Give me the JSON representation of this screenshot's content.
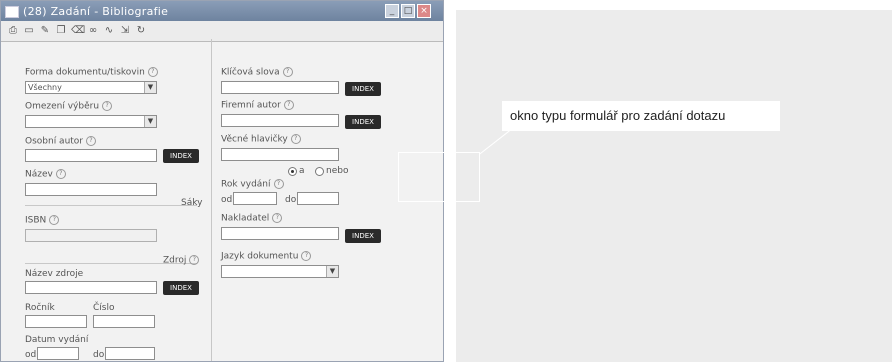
{
  "window": {
    "title": "(28) Zadání - Bibliografie",
    "minimize": "_",
    "maximize": "□",
    "close": "×"
  },
  "toolbar_icons": [
    "print-icon",
    "new-icon",
    "edit-icon",
    "copy-icon",
    "delete-icon",
    "binoculars-icon",
    "attach-icon",
    "export-icon",
    "refresh-icon"
  ],
  "left": {
    "doc_type": {
      "label": "Forma dokumentu/tiskovin",
      "value": "Všechny"
    },
    "collection": {
      "label": "Omezení výběru",
      "value": ""
    },
    "personal_author": {
      "label": "Osobní autor",
      "value": ""
    },
    "title": {
      "label": "Název",
      "value": ""
    },
    "uniform_title_label": "Sáky",
    "isbn": {
      "label": "ISBN",
      "value": ""
    },
    "source_label": "Zdroj",
    "source_title": {
      "label": "Název zdroje",
      "value": ""
    },
    "volume": {
      "label": "Ročník",
      "value": ""
    },
    "number": {
      "label": "Číslo",
      "value": ""
    },
    "year_issue": {
      "label": "Datum vydání"
    },
    "from_label": "od",
    "to_label": "do"
  },
  "right": {
    "keywords": {
      "label": "Klíčová slova",
      "value": ""
    },
    "corporate_author": {
      "label": "Firemní autor",
      "value": ""
    },
    "subject_author": {
      "label": "Věcné hlavičky",
      "value": ""
    },
    "radio_a": "a",
    "radio_b": "nebo",
    "year_published": {
      "label": "Rok vydání"
    },
    "from_label": "od",
    "to_label": "do",
    "publisher": {
      "label": "Nakladatel",
      "value": ""
    },
    "language": {
      "label": "Jazyk dokumentu",
      "value": ""
    }
  },
  "button_label": "INDEX",
  "callout": "okno typu formulář pro zadání dotazu"
}
